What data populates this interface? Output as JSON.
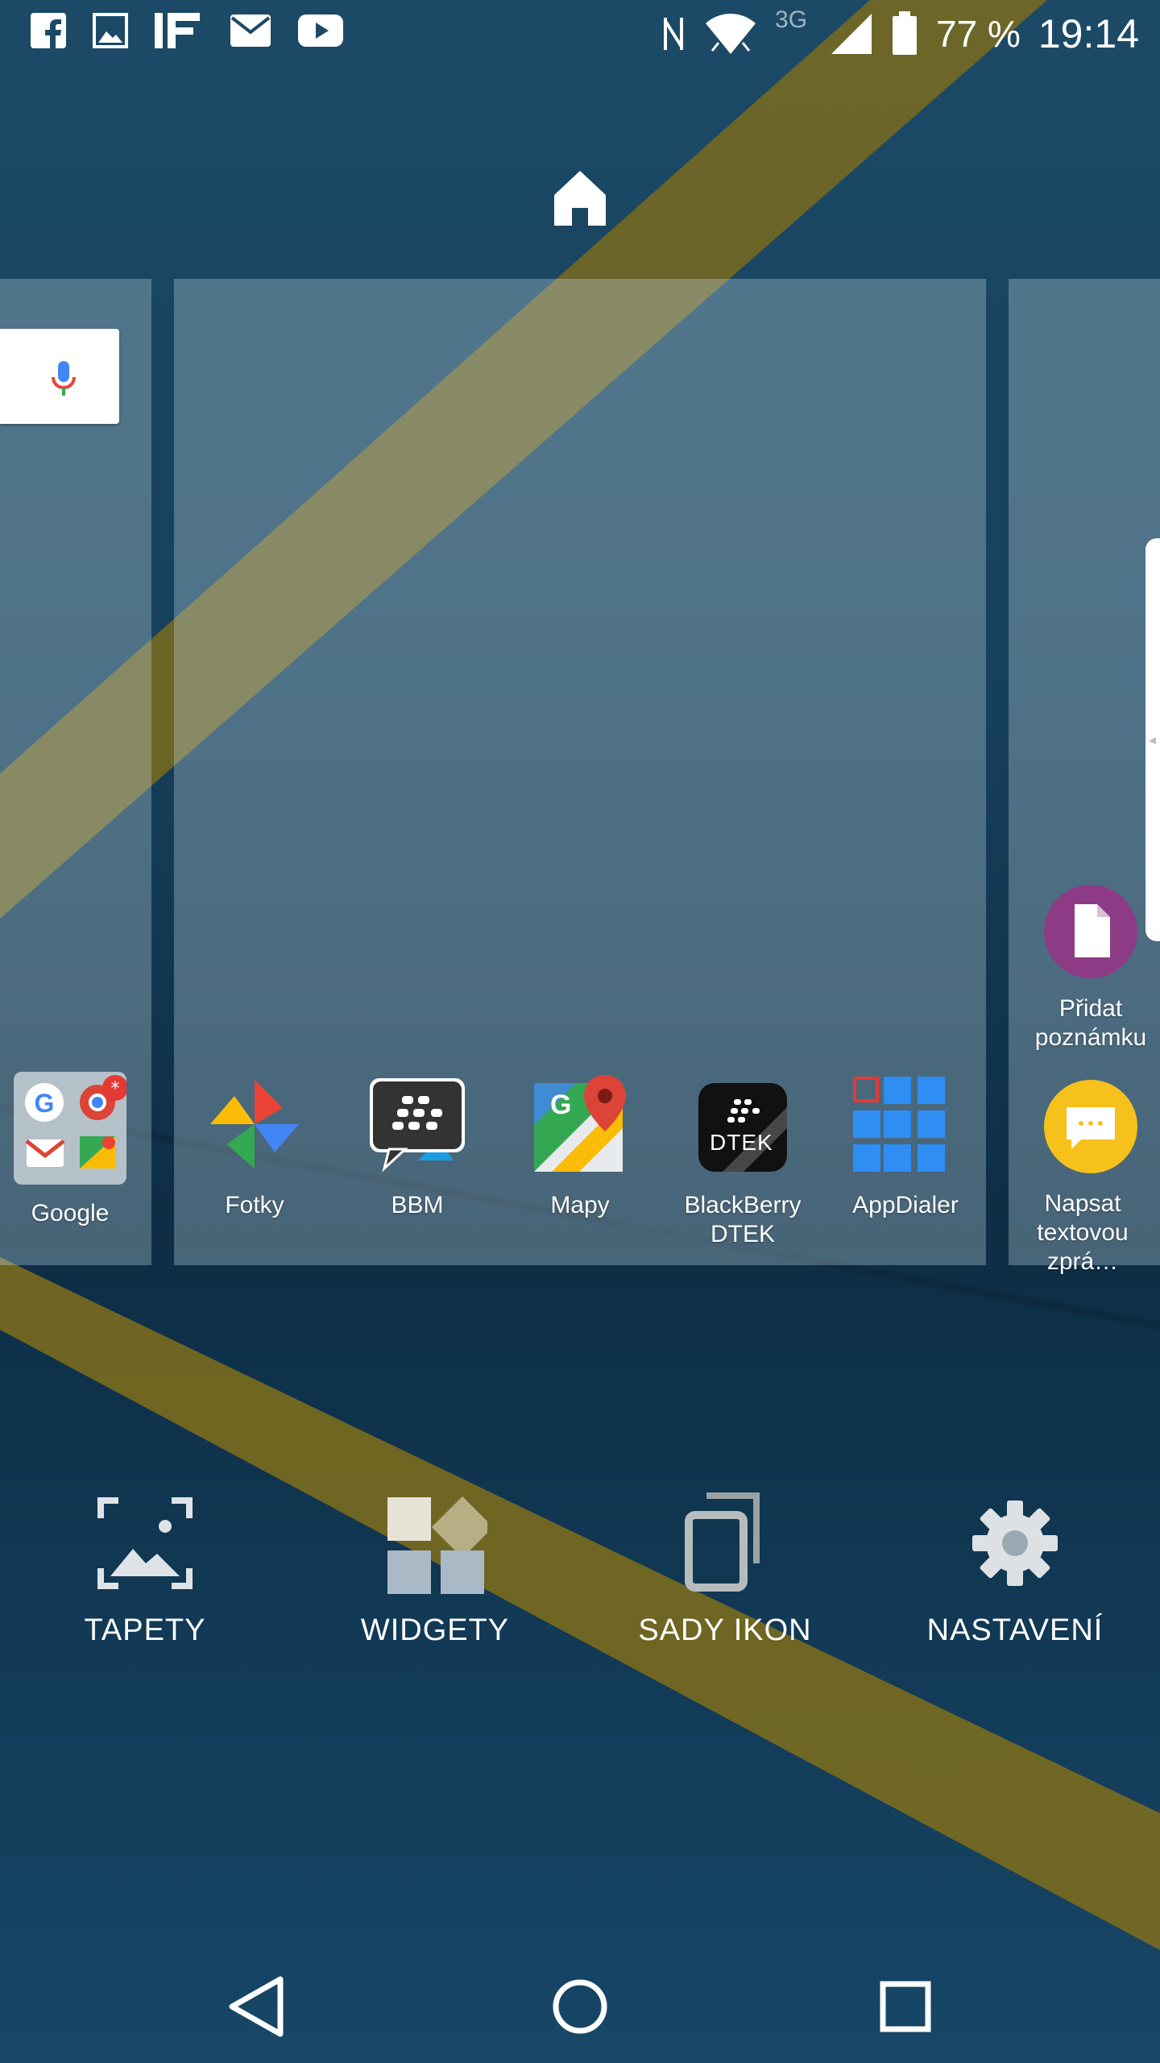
{
  "status_bar": {
    "notification_icons": [
      "facebook-icon",
      "gallery-icon",
      "ifttt-icon",
      "mail-icon",
      "youtube-icon"
    ],
    "network_label": "3G",
    "battery": "77 %",
    "time": "19:14"
  },
  "search_widget": {
    "icon": "mic-icon"
  },
  "apps": [
    {
      "label": "Google",
      "icon": "google-folder-icon"
    },
    {
      "label": "Fotky",
      "icon": "photos-icon"
    },
    {
      "label": "BBM",
      "icon": "bbm-icon"
    },
    {
      "label": "Mapy",
      "icon": "maps-icon"
    },
    {
      "label": "BlackBerry DTEK",
      "icon": "dtek-icon",
      "icon_text": "DTEK"
    },
    {
      "label": "AppDialer",
      "icon": "appdialer-icon"
    },
    {
      "label": "Přidat poznámku",
      "icon": "note-icon"
    },
    {
      "label": "Napsat textovou zprá…",
      "icon": "message-icon"
    }
  ],
  "options": [
    {
      "label": "TAPETY",
      "icon": "wallpaper-icon"
    },
    {
      "label": "WIDGETY",
      "icon": "widgets-icon"
    },
    {
      "label": "SADY IKON",
      "icon": "icon-packs-icon"
    },
    {
      "label": "NASTAVENÍ",
      "icon": "settings-icon"
    }
  ],
  "nav": {
    "buttons": [
      "back-icon",
      "home-circle-icon",
      "recents-icon"
    ]
  },
  "colors": {
    "accent_band": "#7a6b1e",
    "page_overlay": "#c8dce6"
  }
}
